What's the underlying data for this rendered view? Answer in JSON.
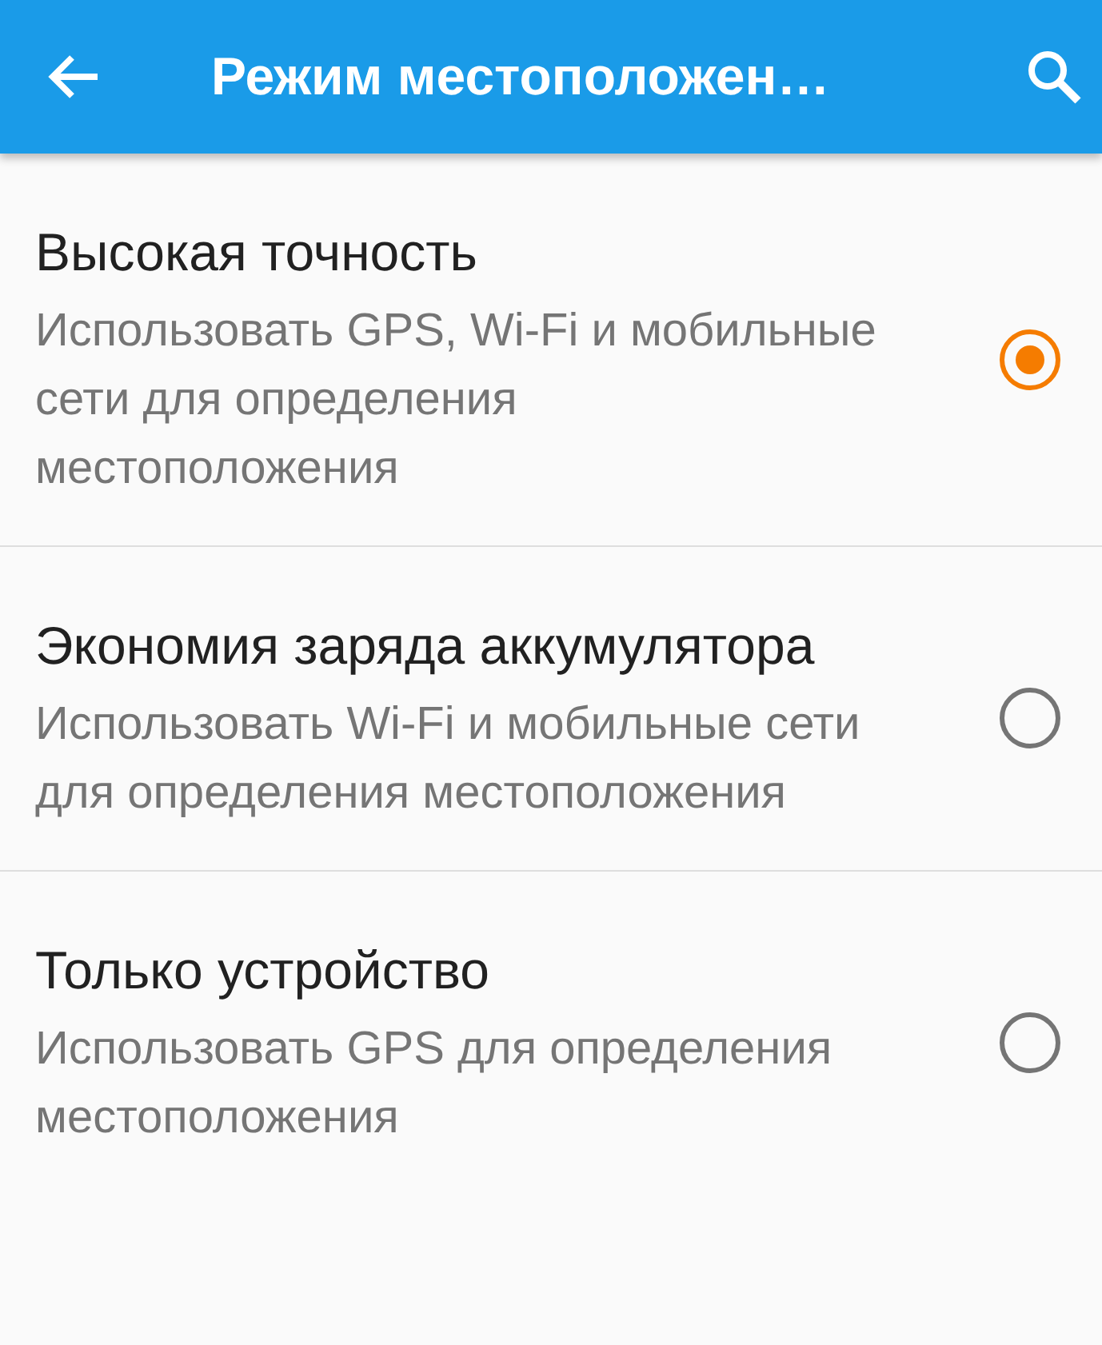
{
  "app_bar": {
    "title": "Режим местоположен…"
  },
  "options": [
    {
      "title": "Высокая точность",
      "summary": "Использовать GPS, Wi-Fi и мобильные сети для определения местоположения",
      "selected": true
    },
    {
      "title": "Экономия заряда аккумулятора",
      "summary": "Использовать Wi-Fi и мобильные сети для определения местоположения",
      "selected": false
    },
    {
      "title": "Только устройство",
      "summary": "Использовать GPS для определения местоположения",
      "selected": false
    }
  ]
}
